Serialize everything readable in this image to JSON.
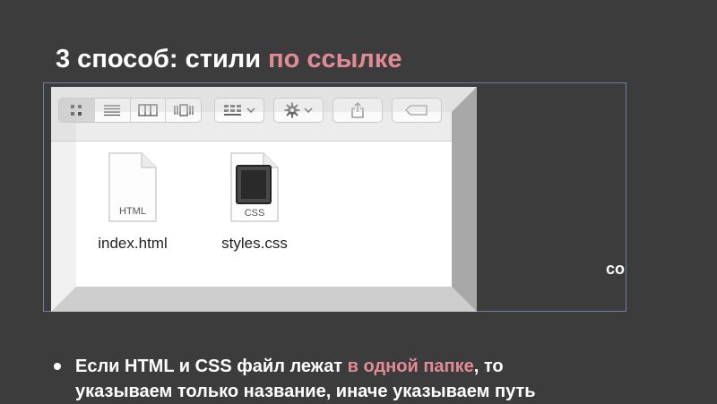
{
  "slide": {
    "title_prefix": "3 способ: стили ",
    "title_accent": "по ссылке",
    "partial_text_right": "со",
    "bullet": {
      "part1": "Если HTML и CSS файл лежат ",
      "accent": "в одной папке",
      "part2": ", то",
      "line2": "указываем только название, иначе указываем путь"
    }
  },
  "finder": {
    "view_buttons": [
      "icon-view",
      "list-view",
      "column-view",
      "cover-flow-view"
    ],
    "files": [
      {
        "name": "index.html",
        "type_label": "HTML"
      },
      {
        "name": "styles.css",
        "type_label": "CSS"
      }
    ]
  },
  "colors": {
    "background": "#3c3c3c",
    "accent": "#e28b96",
    "selection_frame": "#6f7ea8"
  }
}
